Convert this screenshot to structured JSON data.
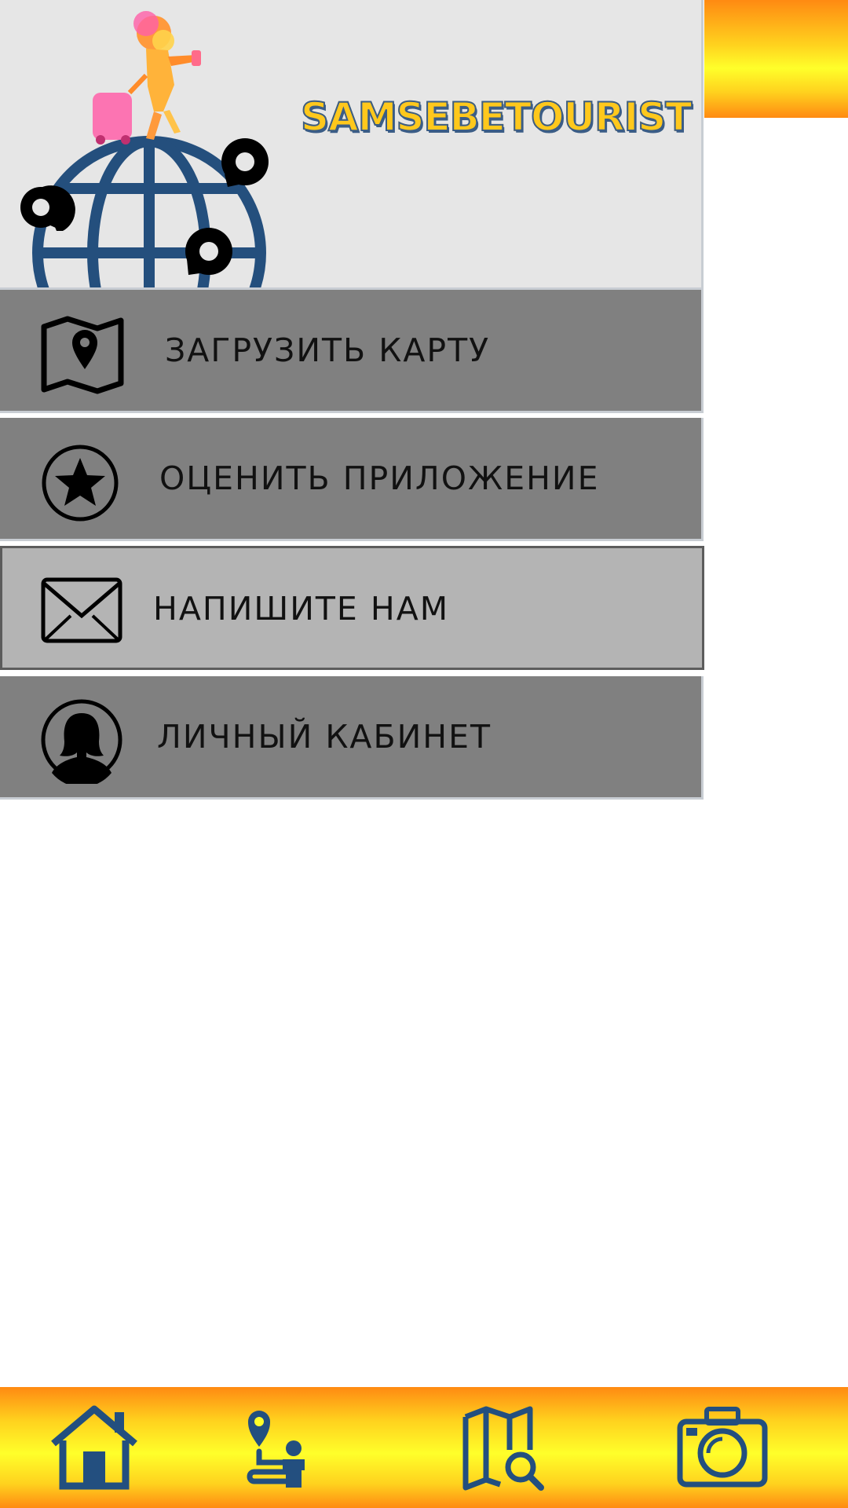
{
  "app": {
    "brand_name": "SAMSEBETOURIST",
    "colors": {
      "accent_orange": "#ff8a12",
      "accent_yellow": "#ffff2a",
      "icon_blue": "#234f7f",
      "menu_gray": "#808080",
      "menu_selected": "#b4b4b4",
      "header_bg": "#e6e6e6"
    }
  },
  "drawer": {
    "logo": {
      "icon": "globe-traveler-logo"
    },
    "items": [
      {
        "label": "ЗАГРУЗИТЬ КАРТУ",
        "icon": "map-pin-icon",
        "selected": false
      },
      {
        "label": "ОЦЕНИТЬ ПРИЛОЖЕНИЕ",
        "icon": "star-icon",
        "selected": false
      },
      {
        "label": "НАПИШИТЕ НАМ",
        "icon": "envelope-icon",
        "selected": true
      },
      {
        "label": "ЛИЧНЫЙ КАБИНЕТ",
        "icon": "user-profile-icon",
        "selected": false
      }
    ]
  },
  "bottom_nav": {
    "items": [
      {
        "icon": "home-icon"
      },
      {
        "icon": "route-pin-person-icon"
      },
      {
        "icon": "map-search-icon"
      },
      {
        "icon": "camera-icon"
      }
    ]
  }
}
